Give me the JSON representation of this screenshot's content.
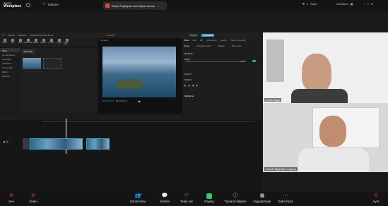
{
  "app": {
    "brand_top": "zoom",
    "brand_name": "Workplace",
    "meeting_label": "Toplantı"
  },
  "tab": {
    "title": "Ekran Paylaşımı adlı kişinin ekranı"
  },
  "top_right": {
    "record": "Kayıt",
    "view": "Görünüm"
  },
  "capcut": {
    "menu": [
      "Toplantı",
      "Düzenle",
      "Ekle",
      "Görünüm"
    ],
    "project_name": "Untitled1 Apr 2024 14:19",
    "time": "17:12 (3)",
    "share_btn": "Paylaş",
    "export_btn": "Dışa aktar",
    "tools": [
      "Medya",
      "Ses",
      "Metin",
      "Çıkartmalar",
      "Efektler",
      "Geçişler",
      "Filtreler",
      "Ayarla",
      "Yapay zekâ"
    ],
    "side_items": [
      "Yerel",
      "İçe aktarılanlar",
      "Alt projeler",
      "Kütüphane",
      "Yapay zekâ",
      "Ekibim",
      "Ekipman"
    ],
    "import_tab": "İçe aktar",
    "player_label": "Oynatıcı",
    "timecode": "00:00:30:03",
    "duration": "00:00:30:10",
    "inspector_tabs": [
      "Video",
      "Ses",
      "Hız",
      "Animasyon",
      "Ayarla",
      "Yapay zekâ etkili"
    ],
    "inspector_sub": [
      "Temel",
      "Arka plan kaldır",
      "Maske",
      "Retuş yap"
    ],
    "inspector_section": "Görünüş",
    "scale_label": "Ölçek",
    "scale_value": "100%",
    "position_label": "Konum",
    "rotate_label": "Döndür",
    "blend_label": "Karışım",
    "opacity_value": "100%",
    "stabilize_label": "Sabitleme"
  },
  "participants": [
    {
      "name": "Emre Kaya"
    },
    {
      "name": "Ahmet Bilgehan Coşkun"
    }
  ],
  "bottom_bar": [
    {
      "label": "Ses",
      "icon": "microphone-muted-icon"
    },
    {
      "label": "Video",
      "icon": "camera-off-icon"
    },
    {
      "label": "Katılımcılar",
      "icon": "participants-icon",
      "count": "2"
    },
    {
      "label": "Sohbet",
      "icon": "chat-icon"
    },
    {
      "label": "Tepki ver",
      "icon": "heart-icon"
    },
    {
      "label": "Paylaş",
      "icon": "share-icon"
    },
    {
      "label": "Toplantı bilgileri",
      "icon": "info-icon"
    },
    {
      "label": "Uygulamalar",
      "icon": "apps-icon"
    },
    {
      "label": "Daha fazla",
      "icon": "more-icon"
    },
    {
      "label": "Ayrıl",
      "icon": "leave-icon"
    }
  ],
  "colors": {
    "accent": "#2ea7c7",
    "danger": "#e8473b",
    "share": "#2ec46a"
  }
}
